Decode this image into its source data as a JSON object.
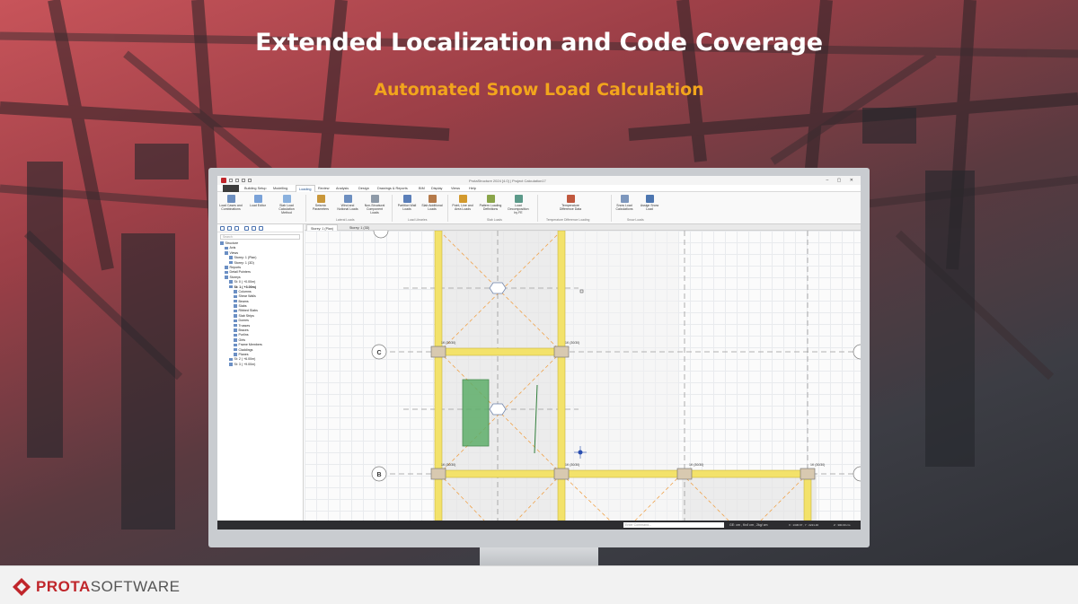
{
  "headline": "Extended Localization and Code Coverage",
  "subline": "Automated Snow Load Calculation",
  "brand": {
    "part1": "PROTA",
    "part2": "SOFTWARE"
  },
  "window": {
    "title": "ProtaStructure 2024 [4.0] | Project Calculation17",
    "controls": "– ▢ ✕"
  },
  "menu": {
    "tabs": [
      "Building Setup",
      "Modelling",
      "Loading",
      "Review",
      "Analysis",
      "Design",
      "Drawings & Reports",
      "BIM",
      "Display",
      "Views",
      "Help"
    ],
    "active": "Loading"
  },
  "ribbon": {
    "buttons": [
      {
        "label": "Load Cases and Combinations",
        "group": "",
        "icon_color": "#6d8fc0"
      },
      {
        "label": "Load Editor",
        "group": "",
        "icon_color": "#7aa2d8"
      },
      {
        "label": "Slab Load Calculation Method",
        "group": "",
        "icon_color": "#8ab1de"
      },
      {
        "label": "Seismic Parameters",
        "group": "Lateral Loads",
        "icon_color": "#c9973a"
      },
      {
        "label": "Wind and Notional Loads",
        "group": "Lateral Loads",
        "icon_color": "#6d8fc0"
      },
      {
        "label": "Non-Structural Component Loads",
        "group": "Lateral Loads",
        "icon_color": "#8e9aa8"
      },
      {
        "label": "Partition Wall Loads",
        "group": "Load Libraries",
        "icon_color": "#5b7fb9"
      },
      {
        "label": "Slab Additional Loads",
        "group": "Load Libraries",
        "icon_color": "#b57a4a"
      },
      {
        "label": "Point, Line and Area Loads",
        "group": "Slab Loads",
        "icon_color": "#d39a2e"
      },
      {
        "label": "Pattern Loading Definitions",
        "group": "Slab Loads",
        "icon_color": "#8aa54a"
      },
      {
        "label": "Load Decomposition by FE",
        "group": "Slab Loads",
        "icon_color": "#5c9a8a"
      },
      {
        "label": "Temperature Difference Data",
        "group": "Temperature Difference Loading",
        "icon_color": "#c0583e"
      },
      {
        "label": "Snow Load Calculations",
        "group": "Snow Loads",
        "icon_color": "#7d97bd"
      },
      {
        "label": "Assign Snow Load",
        "group": "Snow Loads",
        "icon_color": "#4d76b0"
      }
    ],
    "groups": [
      "Lateral Loads",
      "Load Libraries",
      "Slab Loads",
      "Temperature Difference Loading",
      "Snow Loads"
    ]
  },
  "left_panel": {
    "search_placeholder": "Search",
    "tree": [
      {
        "label": "Structure",
        "indent": 0,
        "bold": false
      },
      {
        "label": "Axis",
        "indent": 1,
        "bold": false
      },
      {
        "label": "Views",
        "indent": 1,
        "bold": false
      },
      {
        "label": "Storey: 1 (Plan)",
        "indent": 2,
        "bold": false
      },
      {
        "label": "Storey: 1 (3D)",
        "indent": 2,
        "bold": false
      },
      {
        "label": "Reports",
        "indent": 1,
        "bold": false
      },
      {
        "label": "Detail Pointers",
        "indent": 1,
        "bold": false
      },
      {
        "label": "Storeys",
        "indent": 1,
        "bold": false
      },
      {
        "label": "St: 0 ( +0.00m)",
        "indent": 2,
        "bold": false
      },
      {
        "label": "St: 1 ( +3.00m)",
        "indent": 2,
        "bold": true
      },
      {
        "label": "Columns",
        "indent": 3,
        "bold": false
      },
      {
        "label": "Shear Walls",
        "indent": 3,
        "bold": false
      },
      {
        "label": "Beams",
        "indent": 3,
        "bold": false
      },
      {
        "label": "Slabs",
        "indent": 3,
        "bold": false
      },
      {
        "label": "Ribbed Slabs",
        "indent": 3,
        "bold": false
      },
      {
        "label": "Slab Strips",
        "indent": 3,
        "bold": false
      },
      {
        "label": "Domes",
        "indent": 3,
        "bold": false
      },
      {
        "label": "Trusses",
        "indent": 3,
        "bold": false
      },
      {
        "label": "Braces",
        "indent": 3,
        "bold": false
      },
      {
        "label": "Purlins",
        "indent": 3,
        "bold": false
      },
      {
        "label": "Girts",
        "indent": 3,
        "bold": false
      },
      {
        "label": "Frame Members",
        "indent": 3,
        "bold": false
      },
      {
        "label": "Claddings",
        "indent": 3,
        "bold": false
      },
      {
        "label": "Planes",
        "indent": 3,
        "bold": false
      },
      {
        "label": "St: 2 ( +6.00m)",
        "indent": 2,
        "bold": false
      },
      {
        "label": "St: 3 ( +9.00m)",
        "indent": 2,
        "bold": false
      }
    ]
  },
  "doc_tabs": [
    "Storey: 1 (Plan)",
    "Storey: 1 (3D)"
  ],
  "canvas": {
    "axis_labels": [
      "C",
      "B"
    ],
    "column_labels": [
      "1K (30/30)",
      "1K (30/30)",
      "1K (30/30)",
      "1K (30/30)",
      "1K (30/30)",
      "1K (30/30)",
      "1K (30/30)"
    ]
  },
  "status": {
    "command_placeholder": "Enter Command...",
    "units": "GE: cm , Kn/l cm , 2kg/ cm",
    "coords": "X : 1336.67 , Y : 2221.46",
    "zoom": "Z : 300.00 cm"
  }
}
